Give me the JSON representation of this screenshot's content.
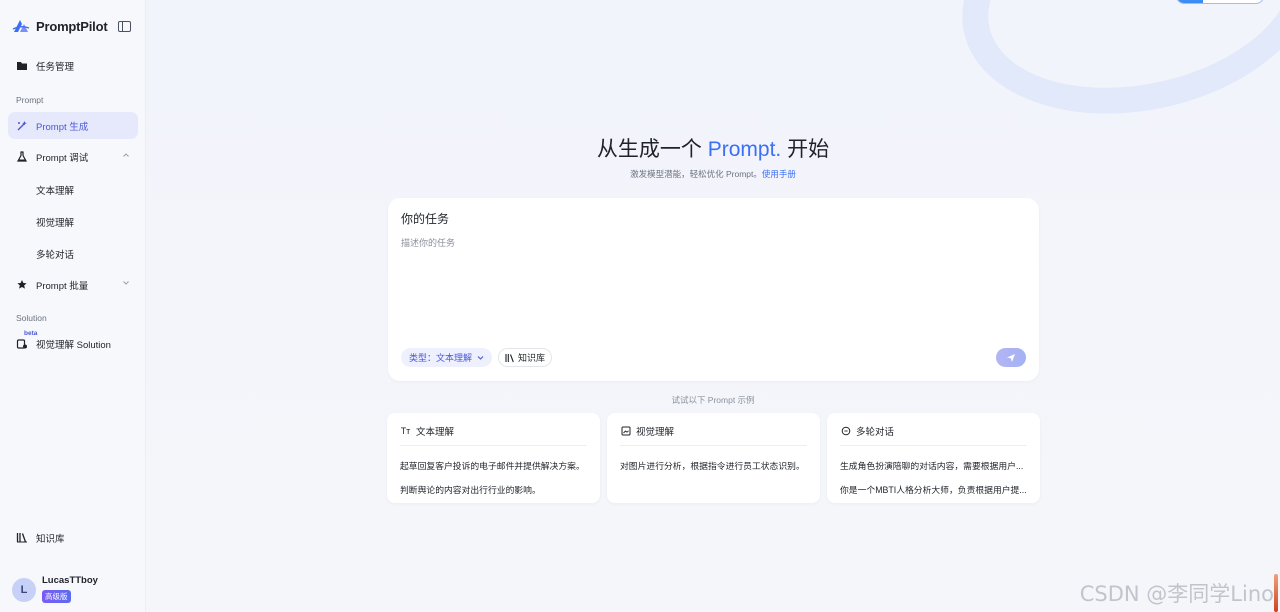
{
  "brand": {
    "name": "PromptPilot"
  },
  "sidebar": {
    "task_manage": "任务管理",
    "section_prompt": "Prompt",
    "prompt_generate": "Prompt 生成",
    "prompt_debug": "Prompt 调试",
    "debug_children": [
      "文本理解",
      "视觉理解",
      "多轮对话"
    ],
    "prompt_batch": "Prompt 批量",
    "section_solution": "Solution",
    "solution_beta": "beta",
    "solution_visual": "视觉理解 Solution",
    "knowledge_base": "知识库"
  },
  "user": {
    "avatar_letter": "L",
    "name": "LucasTTboy",
    "plan": "高级版"
  },
  "hero": {
    "title_pre": "从生成一个 ",
    "title_accent": "Prompt.",
    "title_post": " 开始",
    "subtitle": "激发模型潜能，轻松优化 Prompt。",
    "manual_link": "使用手册"
  },
  "task": {
    "title": "你的任务",
    "placeholder": "描述你的任务",
    "type_label": "类型：",
    "type_value": "文本理解",
    "knowledge_label": "知识库"
  },
  "examples": {
    "label": "试试以下 Prompt 示例",
    "cards": [
      {
        "title": "文本理解",
        "icon": "Tт",
        "lines": [
          "起草回复客户投诉的电子邮件并提供解决方案。",
          "判断舆论的内容对出行行业的影响。"
        ]
      },
      {
        "title": "视觉理解",
        "icon": "image-icon",
        "lines": [
          "对图片进行分析，根据指令进行员工状态识别。"
        ]
      },
      {
        "title": "多轮对话",
        "icon": "chat-icon",
        "lines": [
          "生成角色扮演陪聊的对话内容，需要根据用户...",
          "你是一个MBTI人格分析大师，负责根据用户提..."
        ]
      }
    ]
  },
  "watermark": "CSDN @李同学Lino",
  "colors": {
    "accent": "#3b6ff5",
    "active_nav": "#4b57d9",
    "active_bg": "#e6e9fb"
  }
}
